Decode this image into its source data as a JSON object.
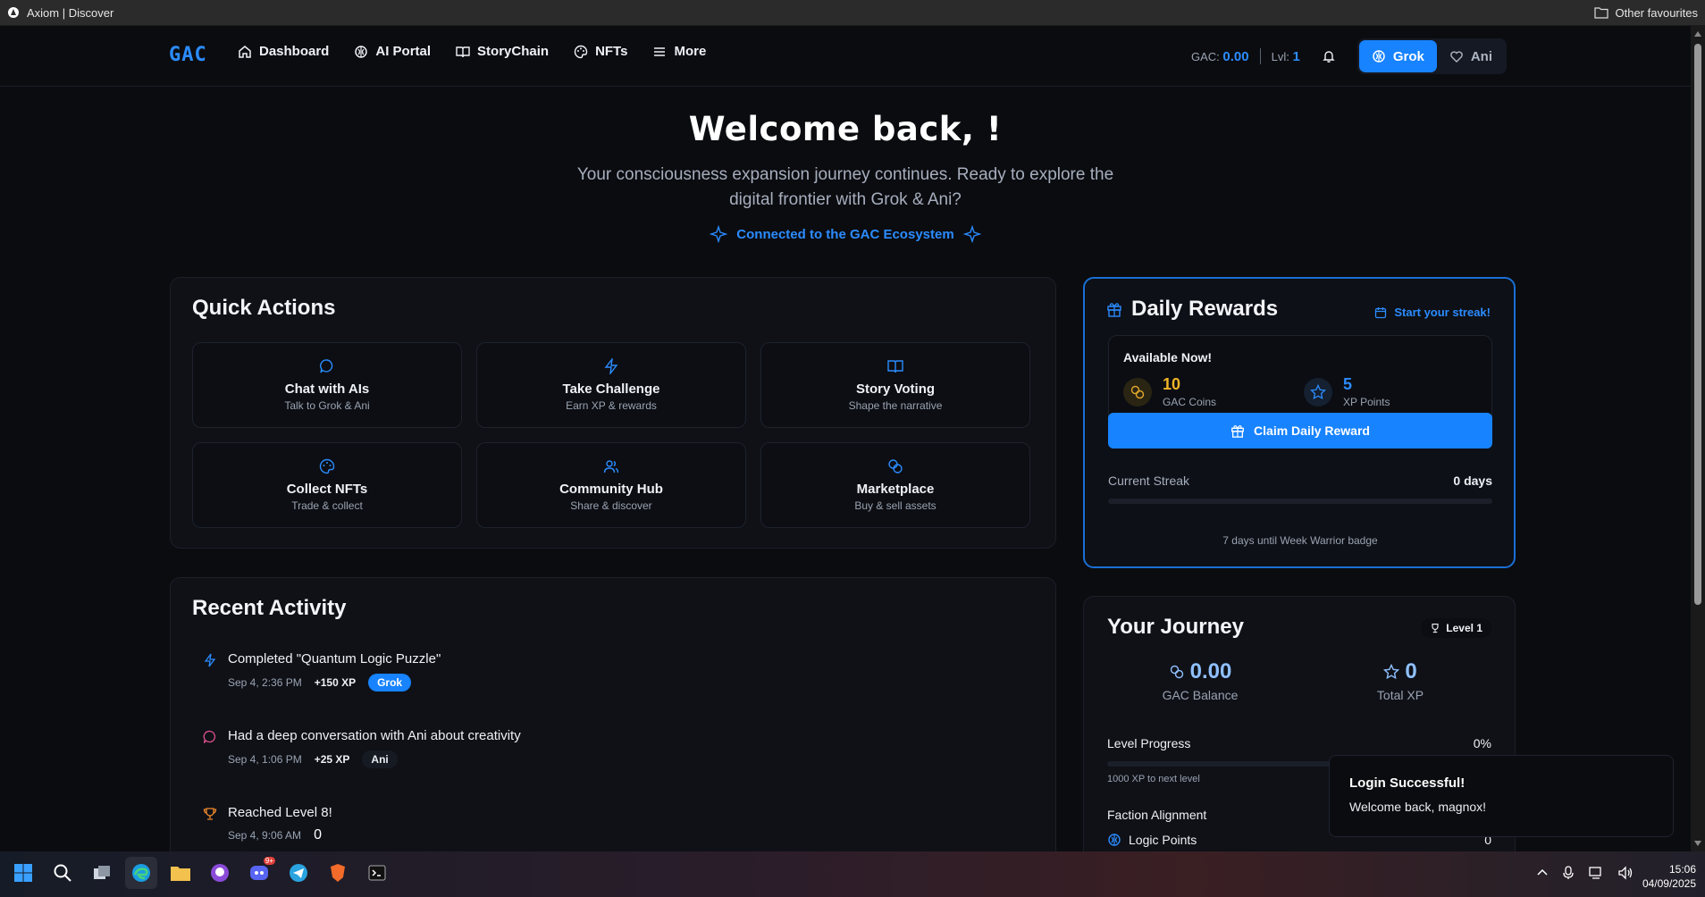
{
  "browser": {
    "tab_title": "Axiom | Discover",
    "favourites": "Other favourites"
  },
  "nav": {
    "logo": "GAC",
    "links": [
      "Dashboard",
      "AI Portal",
      "StoryChain",
      "NFTs",
      "More"
    ],
    "gac_label": "GAC:",
    "gac_value": "0.00",
    "lvl_label": "Lvl:",
    "lvl_value": "1",
    "toggle": {
      "grok": "Grok",
      "ani": "Ani"
    }
  },
  "hero": {
    "title": "Welcome back, !",
    "subtitle": "Your consciousness expansion journey continues. Ready to explore the digital frontier with Grok & Ani?",
    "connected": "Connected to the GAC Ecosystem"
  },
  "quick_actions": {
    "title": "Quick Actions",
    "items": [
      {
        "title": "Chat with AIs",
        "sub": "Talk to Grok & Ani",
        "icon": "chat-icon"
      },
      {
        "title": "Take Challenge",
        "sub": "Earn XP & rewards",
        "icon": "bolt-icon"
      },
      {
        "title": "Story Voting",
        "sub": "Shape the narrative",
        "icon": "book-icon"
      },
      {
        "title": "Collect NFTs",
        "sub": "Trade & collect",
        "icon": "palette-icon"
      },
      {
        "title": "Community Hub",
        "sub": "Share & discover",
        "icon": "users-icon"
      },
      {
        "title": "Marketplace",
        "sub": "Buy & sell assets",
        "icon": "coins-icon"
      }
    ]
  },
  "daily_rewards": {
    "title": "Daily Rewards",
    "streak_link": "Start your streak!",
    "available": "Available Now!",
    "coins_value": "10",
    "coins_label": "GAC Coins",
    "xp_value": "5",
    "xp_label": "XP Points",
    "claim": "Claim Daily Reward",
    "current_streak_label": "Current Streak",
    "current_streak_value": "0 days",
    "streak_progress": 0,
    "badge_note": "7 days until Week Warrior badge"
  },
  "recent_activity": {
    "title": "Recent Activity",
    "items": [
      {
        "title": "Completed \"Quantum Logic Puzzle\"",
        "time": "Sep 4, 2:36 PM",
        "xp": "+150 XP",
        "tag": "Grok"
      },
      {
        "title": "Had a deep conversation with Ani about creativity",
        "time": "Sep 4, 1:06 PM",
        "xp": "+25 XP",
        "tag": "Ani"
      },
      {
        "title": "Reached Level 8!",
        "time": "Sep 4, 9:06 AM",
        "xp": "0",
        "tag": ""
      }
    ]
  },
  "journey": {
    "title": "Your Journey",
    "level_badge": "Level 1",
    "gac_balance": "0.00",
    "gac_balance_label": "GAC Balance",
    "total_xp": "0",
    "total_xp_label": "Total XP",
    "level_progress_label": "Level Progress",
    "level_progress_value": "0%",
    "level_progress": 0,
    "next_level_note": "1000 XP to next level",
    "faction_label": "Faction Alignment",
    "logic_points_label": "Logic Points",
    "logic_points_value": "0"
  },
  "toast": {
    "title": "Login Successful!",
    "message": "Welcome back, magnox!"
  },
  "taskbar": {
    "time": "15:06",
    "date": "04/09/2025",
    "discord_badge": "9+"
  },
  "colors": {
    "accent": "#1783ff",
    "background": "#0b0c10",
    "ani_pink": "#e0508f",
    "challenge_orange": "#f08a2c"
  }
}
